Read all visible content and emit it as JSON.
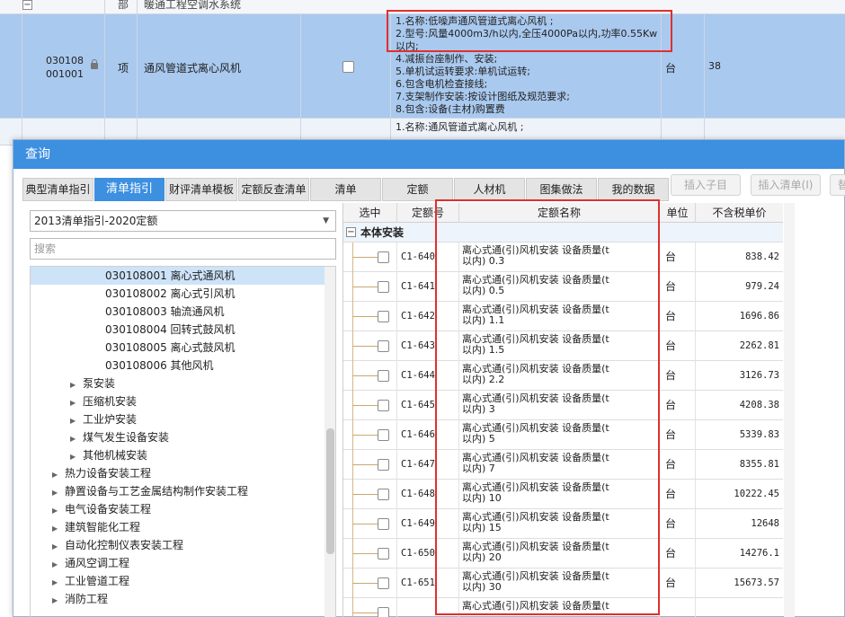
{
  "background": {
    "row_section": {
      "type": "部",
      "name": "暖通工程空调水系统"
    },
    "row_selected": {
      "code_line1": "030108",
      "code_line2": "001001",
      "type": "项",
      "name": "通风管道式离心风机",
      "unit": "台",
      "qty": "38",
      "desc": [
        "1.名称:低噪声通风管道式离心风机 ;",
        "2.型号:风量4000m3/h以内,全压4000Pa以内,功率0.55Kw",
        "以内;",
        "4.减振台座制作、安装;",
        "5.单机试运转要求:单机试运转;",
        "6.包含电机检查接线;",
        "7.支架制作安装:按设计图纸及规范要求;",
        "8.包含:设备(主材)购置费"
      ]
    },
    "row_next": {
      "desc": [
        "1.名称:通风管道式离心风机 ;"
      ]
    }
  },
  "dialog": {
    "title": "查询",
    "tabs": [
      {
        "label": "典型清单指引",
        "state": "normal"
      },
      {
        "label": "清单指引",
        "state": "active"
      },
      {
        "label": "财评清单模板",
        "state": "normal"
      },
      {
        "label": "定额反查清单",
        "state": "normal"
      },
      {
        "label": "清单",
        "state": "normal"
      },
      {
        "label": "定额",
        "state": "normal"
      },
      {
        "label": "人材机",
        "state": "normal"
      },
      {
        "label": "图集做法",
        "state": "normal"
      },
      {
        "label": "我的数据",
        "state": "normal"
      },
      {
        "label": "插入子目",
        "state": "disabled"
      },
      {
        "label": "插入清单(I)",
        "state": "disabled"
      },
      {
        "label": "替",
        "state": "disabled"
      }
    ],
    "left": {
      "selected_library": "2013清单指引-2020定额",
      "search_placeholder": "搜索",
      "tree": [
        {
          "label": "030108001  离心式通风机",
          "level": 3,
          "selected": true
        },
        {
          "label": "030108002  离心式引风机",
          "level": 3
        },
        {
          "label": "030108003  轴流通风机",
          "level": 3
        },
        {
          "label": "030108004  回转式鼓风机",
          "level": 3
        },
        {
          "label": "030108005  离心式鼓风机",
          "level": 3
        },
        {
          "label": "030108006  其他风机",
          "level": 3
        },
        {
          "label": "泵安装",
          "level": 2,
          "arrow": true
        },
        {
          "label": "压缩机安装",
          "level": 2,
          "arrow": true
        },
        {
          "label": "工业炉安装",
          "level": 2,
          "arrow": true
        },
        {
          "label": "煤气发生设备安装",
          "level": 2,
          "arrow": true
        },
        {
          "label": "其他机械安装",
          "level": 2,
          "arrow": true
        },
        {
          "label": "热力设备安装工程",
          "level": 1,
          "arrow": true
        },
        {
          "label": "静置设备与工艺金属结构制作安装工程",
          "level": 1,
          "arrow": true
        },
        {
          "label": "电气设备安装工程",
          "level": 1,
          "arrow": true
        },
        {
          "label": "建筑智能化工程",
          "level": 1,
          "arrow": true
        },
        {
          "label": "自动化控制仪表安装工程",
          "level": 1,
          "arrow": true
        },
        {
          "label": "通风空调工程",
          "level": 1,
          "arrow": true
        },
        {
          "label": "工业管道工程",
          "level": 1,
          "arrow": true
        },
        {
          "label": "消防工程",
          "level": 1,
          "arrow": true
        }
      ]
    },
    "grid": {
      "headers": {
        "select": "选中",
        "code": "定额号",
        "name": "定额名称",
        "unit": "单位",
        "price": "不含税单价"
      },
      "group": {
        "toggle": "−",
        "label": "本体安装"
      },
      "rows": [
        {
          "code": "C1-640",
          "name1": "离心式通(引)风机安装 设备质量(t",
          "name2": "以内) 0.3",
          "unit": "台",
          "price": "838.42"
        },
        {
          "code": "C1-641",
          "name1": "离心式通(引)风机安装 设备质量(t",
          "name2": "以内) 0.5",
          "unit": "台",
          "price": "979.24"
        },
        {
          "code": "C1-642",
          "name1": "离心式通(引)风机安装 设备质量(t",
          "name2": "以内) 1.1",
          "unit": "台",
          "price": "1696.86"
        },
        {
          "code": "C1-643",
          "name1": "离心式通(引)风机安装 设备质量(t",
          "name2": "以内) 1.5",
          "unit": "台",
          "price": "2262.81"
        },
        {
          "code": "C1-644",
          "name1": "离心式通(引)风机安装 设备质量(t",
          "name2": "以内) 2.2",
          "unit": "台",
          "price": "3126.73"
        },
        {
          "code": "C1-645",
          "name1": "离心式通(引)风机安装 设备质量(t",
          "name2": "以内) 3",
          "unit": "台",
          "price": "4208.38"
        },
        {
          "code": "C1-646",
          "name1": "离心式通(引)风机安装 设备质量(t",
          "name2": "以内) 5",
          "unit": "台",
          "price": "5339.83"
        },
        {
          "code": "C1-647",
          "name1": "离心式通(引)风机安装 设备质量(t",
          "name2": "以内) 7",
          "unit": "台",
          "price": "8355.81"
        },
        {
          "code": "C1-648",
          "name1": "离心式通(引)风机安装 设备质量(t",
          "name2": "以内) 10",
          "unit": "台",
          "price": "10222.45"
        },
        {
          "code": "C1-649",
          "name1": "离心式通(引)风机安装 设备质量(t",
          "name2": "以内) 15",
          "unit": "台",
          "price": "12648"
        },
        {
          "code": "C1-650",
          "name1": "离心式通(引)风机安装 设备质量(t",
          "name2": "以内) 20",
          "unit": "台",
          "price": "14276.1"
        },
        {
          "code": "C1-651",
          "name1": "离心式通(引)风机安装 设备质量(t",
          "name2": "以内) 30",
          "unit": "台",
          "price": "15673.57"
        },
        {
          "code": "",
          "name1": "离心式通(引)风机安装 设备质量(t",
          "name2": "",
          "unit": "",
          "price": ""
        }
      ]
    }
  },
  "colors": {
    "accent": "#3d8fe0",
    "highlight": "#e0302e",
    "selected_row": "#a9c9ef"
  }
}
